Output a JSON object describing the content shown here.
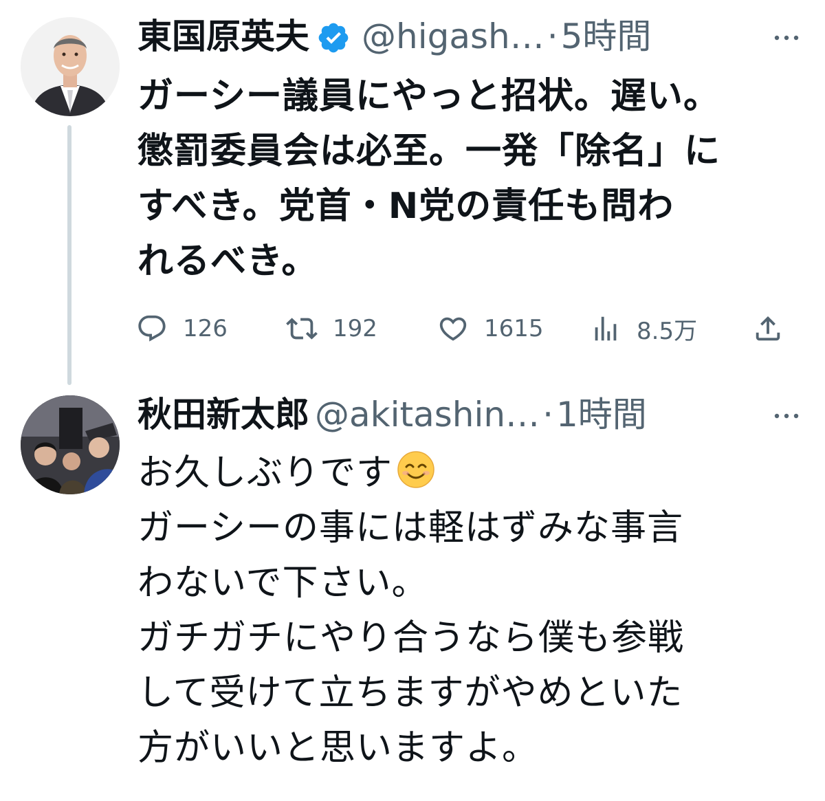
{
  "tweets": [
    {
      "author_name": "東国原英夫",
      "verified_icon": "verified-badge-icon",
      "handle": "@higash…",
      "separator": "·",
      "time": "5時間",
      "more_icon": "more-options-icon",
      "text": "ガーシー議員にやっと招状。遅い。\n懲罰委員会は必至。一発「除名」に\nすべき。党首・N党の責任も問わ\nれるべき。",
      "actions": {
        "replies": "126",
        "retweets": "192",
        "likes": "1615",
        "views": "8.5万"
      }
    },
    {
      "author_name": "秋田新太郎",
      "handle": "@akitashin…",
      "separator": "·",
      "time": "1時間",
      "more_icon": "more-options-icon",
      "text_lines": [
        "お久しぶりです",
        "ガーシーの事には軽はずみな事言",
        "わないで下さい。",
        "ガチガチにやり合うなら僕も参戦",
        "して受けて立ちますがやめといた",
        "方がいいと思いますよ。"
      ],
      "emoji": "smiling-face-emoji"
    }
  ],
  "colors": {
    "text_primary": "#0f1419",
    "text_secondary": "#536471",
    "verified_blue": "#1d9bf0",
    "thread_line": "#cfd9de"
  }
}
